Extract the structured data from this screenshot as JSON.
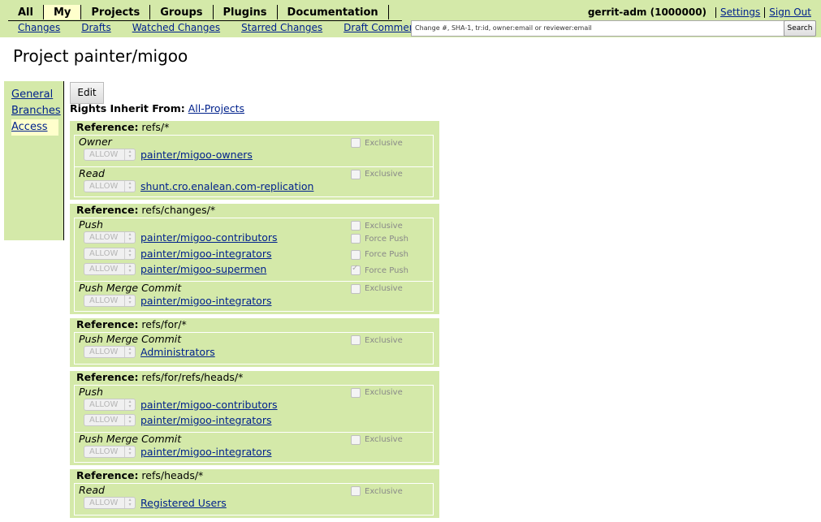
{
  "menu": {
    "primary": [
      "All",
      "My",
      "Projects",
      "Groups",
      "Plugins",
      "Documentation"
    ],
    "selected": "My",
    "secondary": [
      "Changes",
      "Drafts",
      "Watched Changes",
      "Starred Changes",
      "Draft Comments"
    ]
  },
  "user": {
    "name": "gerrit-adm (1000000)",
    "settings": "Settings",
    "signout": "Sign Out"
  },
  "search": {
    "placeholder": "Change #, SHA-1, tr:id, owner:email or reviewer:email",
    "button": "Search"
  },
  "page": {
    "title": "Project painter/migoo"
  },
  "leftnav": [
    "General",
    "Branches",
    "Access"
  ],
  "leftnav_selected": "Access",
  "edit_label": "Edit",
  "inherit": {
    "label": "Rights Inherit From:",
    "project": "All-Projects"
  },
  "labels": {
    "reference": "Reference:",
    "allow": "ALLOW",
    "exclusive": "Exclusive",
    "force_push": "Force Push"
  },
  "sections": [
    {
      "ref": "refs/*",
      "permissions": [
        {
          "name": "Owner",
          "rules": [
            {
              "group": "painter/migoo-owners",
              "force": null
            }
          ]
        },
        {
          "name": "Read",
          "rules": [
            {
              "group": "shunt.cro.enalean.com-replication",
              "force": null
            }
          ]
        }
      ]
    },
    {
      "ref": "refs/changes/*",
      "permissions": [
        {
          "name": "Push",
          "rules": [
            {
              "group": "painter/migoo-contributors",
              "force": false
            },
            {
              "group": "painter/migoo-integrators",
              "force": false
            },
            {
              "group": "painter/migoo-supermen",
              "force": true
            }
          ]
        },
        {
          "name": "Push Merge Commit",
          "rules": [
            {
              "group": "painter/migoo-integrators",
              "force": null
            }
          ]
        }
      ]
    },
    {
      "ref": "refs/for/*",
      "permissions": [
        {
          "name": "Push Merge Commit",
          "rules": [
            {
              "group": "Administrators",
              "force": null
            }
          ]
        }
      ]
    },
    {
      "ref": "refs/for/refs/heads/*",
      "permissions": [
        {
          "name": "Push",
          "rules": [
            {
              "group": "painter/migoo-contributors",
              "force": null
            },
            {
              "group": "painter/migoo-integrators",
              "force": null
            }
          ]
        },
        {
          "name": "Push Merge Commit",
          "rules": [
            {
              "group": "painter/migoo-integrators",
              "force": null
            }
          ]
        }
      ]
    },
    {
      "ref": "refs/heads/*",
      "permissions": [
        {
          "name": "Read",
          "rules": [
            {
              "group": "Registered Users",
              "force": null
            }
          ]
        }
      ]
    }
  ]
}
